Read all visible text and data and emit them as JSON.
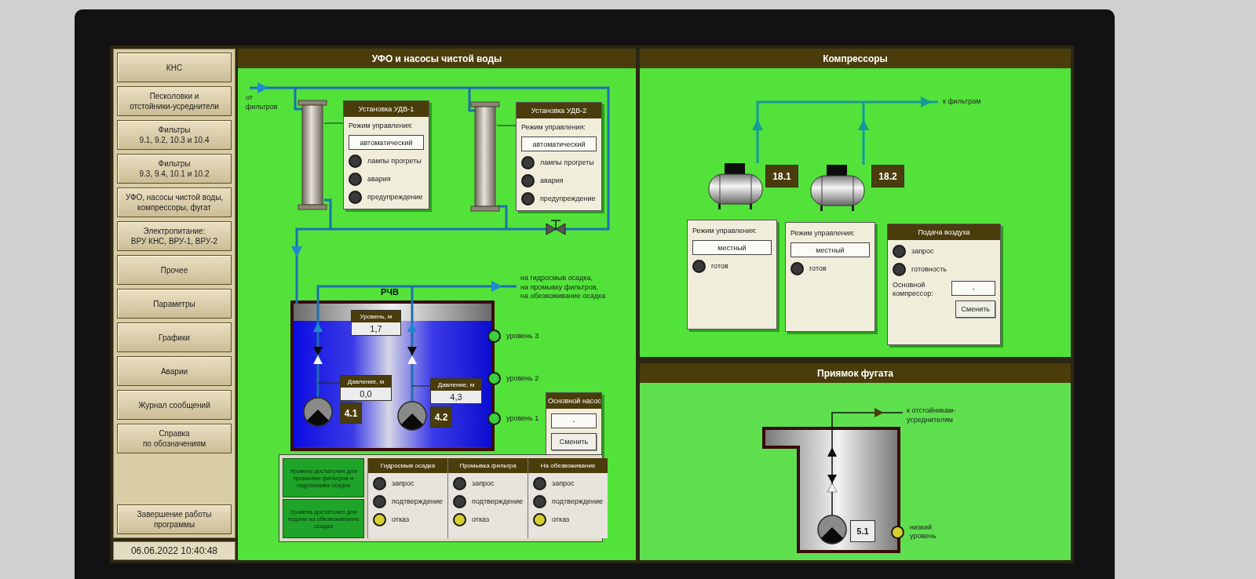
{
  "sidebar": {
    "items": [
      {
        "label": "КНС"
      },
      {
        "label": "Песколовки и\nотстойники-усреднители"
      },
      {
        "label": "Фильтры\n9.1, 9.2, 10.3 и 10.4"
      },
      {
        "label": "Фильтры\n9.3, 9.4, 10.1 и 10.2"
      },
      {
        "label": "УФО, насосы чистой воды,\nкомпрессоры, фугат"
      },
      {
        "label": "Электропитание:\nВРУ КНС, ВРУ-1, ВРУ-2"
      },
      {
        "label": "Прочее"
      },
      {
        "label": "Параметры"
      },
      {
        "label": "Графики"
      },
      {
        "label": "Аварии"
      },
      {
        "label": "Журнал сообщений"
      },
      {
        "label": "Справка\nпо обозначениям"
      }
    ],
    "exit_button": "Завершение работы\nпрограммы",
    "datetime": "06.06.2022 10:40:48"
  },
  "uv_panel": {
    "title": "УФО и насосы чистой воды",
    "inlet_label": "от\nфильтров",
    "units": [
      {
        "title": "Установка УДВ-1",
        "mode_label": "Режим управления:",
        "mode": "автоматический",
        "lamps": [
          {
            "label": "лампы прогреты",
            "color": "#3a3a3a"
          },
          {
            "label": "авария",
            "color": "#3a3a3a"
          },
          {
            "label": "предупреждение",
            "color": "#3a3a3a"
          }
        ]
      },
      {
        "title": "Установка УДВ-2",
        "mode_label": "Режим управления:",
        "mode": "автоматический",
        "lamps": [
          {
            "label": "лампы прогреты",
            "color": "#3a3a3a"
          },
          {
            "label": "авария",
            "color": "#3a3a3a"
          },
          {
            "label": "предупреждение",
            "color": "#3a3a3a"
          }
        ]
      }
    ],
    "tank": {
      "title": "РЧВ",
      "outlet_label": "на гидросмыв осадка,\nна промывку фильтров,\nна обезвоживание осадка",
      "level_label": "Уровень, м",
      "level_value": "1,7",
      "pumps": [
        {
          "pressure_label": "Давление, м",
          "pressure": "0,0",
          "tag": "4.1"
        },
        {
          "pressure_label": "Давление, м",
          "pressure": "4,3",
          "tag": "4.2"
        }
      ],
      "level_lamps": [
        {
          "label": "уровень 3",
          "color": "#3ccf3c"
        },
        {
          "label": "уровень 2",
          "color": "#3ccf3c"
        },
        {
          "label": "уровень 1",
          "color": "#3ccf3c"
        }
      ]
    },
    "main_pump": {
      "title": "Основной насос",
      "value": "-",
      "button": "Сменить"
    },
    "legend": [
      "Уровень достаточен для промывки фильтров и гидросмыва осадка",
      "Уровень достаточен для подачи на обезвоживание осадка"
    ],
    "consumers": [
      {
        "title": "Гидросмыв осадка",
        "lamps": [
          {
            "label": "запрос",
            "color": "#3a3a3a"
          },
          {
            "label": "подтверждение",
            "color": "#3a3a3a"
          },
          {
            "label": "отказ",
            "color": "#d6cf2e"
          }
        ]
      },
      {
        "title": "Промывка фильтра",
        "lamps": [
          {
            "label": "запрос",
            "color": "#3a3a3a"
          },
          {
            "label": "подтверждение",
            "color": "#3a3a3a"
          },
          {
            "label": "отказ",
            "color": "#d6cf2e"
          }
        ]
      },
      {
        "title": "На обезвоживание",
        "lamps": [
          {
            "label": "запрос",
            "color": "#3a3a3a"
          },
          {
            "label": "подтверждение",
            "color": "#3a3a3a"
          },
          {
            "label": "отказ",
            "color": "#d6cf2e"
          }
        ]
      }
    ]
  },
  "compressors": {
    "title": "Компрессоры",
    "outlet_label": "к фильтрам",
    "units": [
      {
        "tag": "18.1",
        "mode_label": "Режим управления:",
        "mode": "местный",
        "lamps": [
          {
            "label": "готов",
            "color": "#3a3a3a"
          }
        ]
      },
      {
        "tag": "18.2",
        "mode_label": "Режим управления:",
        "mode": "местный",
        "lamps": [
          {
            "label": "готов",
            "color": "#3a3a3a"
          }
        ]
      }
    ],
    "air_supply": {
      "title": "Подача воздуха",
      "lamps": [
        {
          "label": "запрос",
          "color": "#3a3a3a"
        },
        {
          "label": "готовность",
          "color": "#3a3a3a"
        }
      ],
      "main_label": "Основной\nкомпрессор:",
      "main_value": "-",
      "button": "Сменить"
    }
  },
  "sump": {
    "title": "Приямок фугата",
    "outlet_label": "к отстойникам-\nусреднителям",
    "pump_tag": "5.1",
    "lamp": {
      "label": "низкий\nуровень",
      "color": "#d6cf2e"
    }
  }
}
